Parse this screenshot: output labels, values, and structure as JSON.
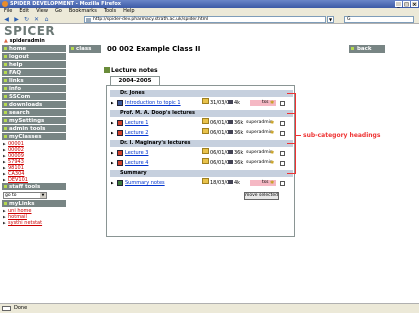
{
  "window": {
    "title": "SPIDER DEVELOPMENT - Mozilla Firefox",
    "controls": [
      "_",
      "□",
      "×"
    ]
  },
  "menubar": [
    "File",
    "Edit",
    "View",
    "Go",
    "Bookmarks",
    "Tools",
    "Help"
  ],
  "navbar": {
    "url": "http://spider-dev.pharmacy.strath.ac.uk/spider.html",
    "search_value": "G"
  },
  "sidebar": {
    "logo": "SPICER",
    "username": "spideradmin",
    "menu": [
      "home",
      "logout",
      "help",
      "FAQ",
      "links",
      "info",
      "SSCom",
      "downloads",
      "search",
      "mySettings",
      "admin tools",
      "myClasses"
    ],
    "classes": [
      "00001",
      "00002",
      "00009",
      "57943",
      "98101",
      "CA304",
      "DEV101"
    ],
    "staff_tools": "staff tools",
    "goto_select": "go to",
    "mylinks_label": "myLinks",
    "mylinks": [
      "uni home",
      "hotmail",
      "systhi netstat"
    ]
  },
  "header": {
    "class_badge": "class",
    "class_title": "00 002 Example Class II",
    "back": "back"
  },
  "content": {
    "section_title": "Lecture notes",
    "year_tab": "2004-2005",
    "categories": [
      {
        "heading": "Dr. Jones",
        "rows": [
          {
            "title": "Introduction to topic 1",
            "date": "31/03/05",
            "size": "4k",
            "owner": "tss",
            "kind": "doc"
          }
        ]
      },
      {
        "heading": "Prof. M. A. Doop's lectures",
        "rows": [
          {
            "title": "Lecture 1",
            "date": "06/01/05",
            "size": "36k",
            "owner": "superadmin",
            "kind": "ppt"
          },
          {
            "title": "Lecture 2",
            "date": "06/01/05",
            "size": "36k",
            "owner": "superadmin",
            "kind": "ppt"
          }
        ]
      },
      {
        "heading": "Dr. I. Maginary's lectures",
        "rows": [
          {
            "title": "Lecture 3",
            "date": "06/01/05",
            "size": "36k",
            "owner": "superadmin",
            "kind": "ppt"
          },
          {
            "title": "Lecture 4",
            "date": "06/01/05",
            "size": "36k",
            "owner": "superadmin",
            "kind": "ppt"
          }
        ]
      },
      {
        "heading": "Summary",
        "rows": [
          {
            "title": "Summary notes",
            "date": "18/03/05",
            "size": "4k",
            "owner": "tss",
            "kind": "sum"
          }
        ]
      }
    ],
    "move_button": "move selected"
  },
  "annotation": {
    "label": "sub-category headings",
    "color": "#e33333"
  },
  "status": "Done"
}
